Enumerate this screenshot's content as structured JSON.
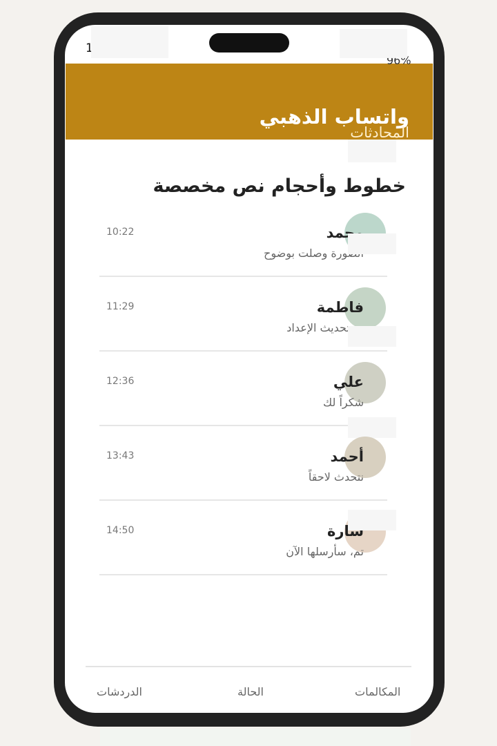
{
  "status_bar": {
    "time": "1",
    "battery": "96%"
  },
  "header": {
    "title": "واتساب الذهبي",
    "subtitle": "المحادثات"
  },
  "section_title": "خطوط وأحجام نص مخصصة",
  "chats": [
    {
      "name": "محمد",
      "preview": "الصورة وصلت بوضوح",
      "time": "10:22",
      "avatar_color": "#bcd7cb"
    },
    {
      "name": "فاطمة",
      "preview": "تم تحديث الإعداد",
      "time": "11:29",
      "avatar_color": "#c5d5c6"
    },
    {
      "name": "علي",
      "preview": "شكراً لك",
      "time": "12:36",
      "avatar_color": "#cfd0c4"
    },
    {
      "name": "أحمد",
      "preview": "نتحدث لاحقاً",
      "time": "13:43",
      "avatar_color": "#d8d0c0"
    },
    {
      "name": "سارة",
      "preview": "تم، سأرسلها الآن",
      "time": "14:50",
      "avatar_color": "#e6d5c6"
    }
  ],
  "bottom_nav": {
    "calls": "المكالمات",
    "status": "الحالة",
    "chats": "الدردشات"
  },
  "colors": {
    "header": "#bd8515",
    "phone_frame": "#222222",
    "background": "#f4f2ee"
  }
}
